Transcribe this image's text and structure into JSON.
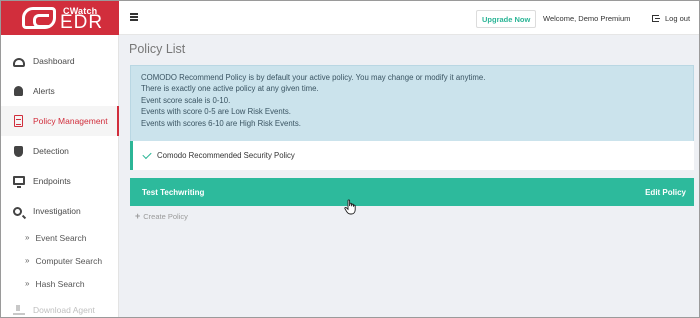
{
  "app": {
    "logo_small": "CWatch",
    "logo_big": "EDR"
  },
  "sidebar": {
    "items": [
      {
        "label": "Dashboard",
        "icon": "dashboard-icon"
      },
      {
        "label": "Alerts",
        "icon": "bell-icon"
      },
      {
        "label": "Policy Management",
        "icon": "document-icon",
        "active": true
      },
      {
        "label": "Detection",
        "icon": "shield-icon"
      },
      {
        "label": "Endpoints",
        "icon": "monitor-icon"
      },
      {
        "label": "Investigation",
        "icon": "search-icon"
      }
    ],
    "subitems": [
      {
        "label": "Event Search"
      },
      {
        "label": "Computer Search"
      },
      {
        "label": "Hash Search"
      }
    ],
    "download_label": "Download Agent"
  },
  "topbar": {
    "upgrade_label": "Upgrade Now",
    "welcome_text": "Welcome, Demo Premium",
    "logout_label": "Log out"
  },
  "main": {
    "title": "Policy List",
    "info_lines": [
      "COMODO Recommend Policy is by default your active policy. You may change or modify it anytime.",
      "There is exactly one active policy at any given time.",
      "Event score scale is 0-10.",
      "Events with score 0-5 are Low Risk Events.",
      "Events with scores 6-10 are High Risk Events."
    ],
    "active_policy": "Comodo Recommended Security Policy",
    "policy_name": "Test Techwriting",
    "edit_label": "Edit Policy",
    "create_label": "Create Policy"
  },
  "colors": {
    "brand_red": "#d12e3c",
    "accent_green": "#2dba9c",
    "info_bg": "#cbe3ec"
  }
}
